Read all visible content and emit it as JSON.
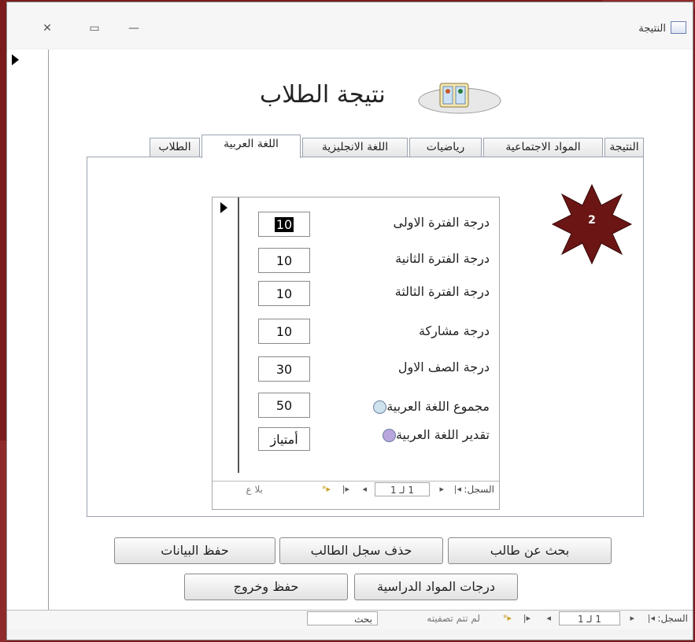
{
  "window": {
    "title": "النتيجة",
    "close_glyph": "✕",
    "restore_glyph": "▭",
    "minimize_glyph": "—"
  },
  "form": {
    "title": "نتيجة الطلاب",
    "tabs": [
      {
        "label": "النتيجة",
        "active": false
      },
      {
        "label": "المواد الاجتماعية",
        "active": false
      },
      {
        "label": "رياضيات",
        "active": false
      },
      {
        "label": "اللغة الانجليزية",
        "active": false
      },
      {
        "label": "اللغة العربية",
        "active": true
      },
      {
        "label": "الطلاب",
        "active": false
      }
    ]
  },
  "subform": {
    "fields": [
      {
        "label": "درجة الفترة الاولى",
        "value": "10"
      },
      {
        "label": "درجة الفترة الثانية",
        "value": "10"
      },
      {
        "label": "درجة الفترة الثالثة",
        "value": "10"
      },
      {
        "label": "درجة مشاركة",
        "value": "10"
      },
      {
        "label": "درجة الصف الاول",
        "value": "30"
      },
      {
        "label": "مجموع اللغة العربية",
        "value": "50"
      },
      {
        "label": "تقدير اللغة العربية",
        "value": "أمتياز"
      }
    ],
    "nav": {
      "record_label": "السجل:",
      "first_glyph": "◂|",
      "prev_glyph": "◂",
      "current": "1 لـ 1",
      "next_glyph": "▸",
      "last_glyph": "▸|",
      "new_glyph": "▸*",
      "filter_text": "بلا ع"
    }
  },
  "buttons": {
    "search_student": "بحث عن طالب",
    "delete_record": "حذف سجل الطالب",
    "save_data": "حفظ البيانات",
    "subject_grades": "درجات المواد الدراسية",
    "save_exit": "حفظ وخروج"
  },
  "mainnav": {
    "record_label": "السجل:",
    "first_glyph": "◂|",
    "prev_glyph": "◂",
    "current": "1 لـ 1",
    "next_glyph": "▸",
    "last_glyph": "▸|",
    "new_glyph": "▸*",
    "filter_text": "لم تتم تصفيته",
    "search_placeholder": "بحث"
  },
  "badge": {
    "text": "2",
    "color": "#6b1515"
  },
  "colors": {
    "background": "#7a1c1c",
    "bullet1": "#cfe3ef",
    "bullet2": "#b9a6dc"
  }
}
